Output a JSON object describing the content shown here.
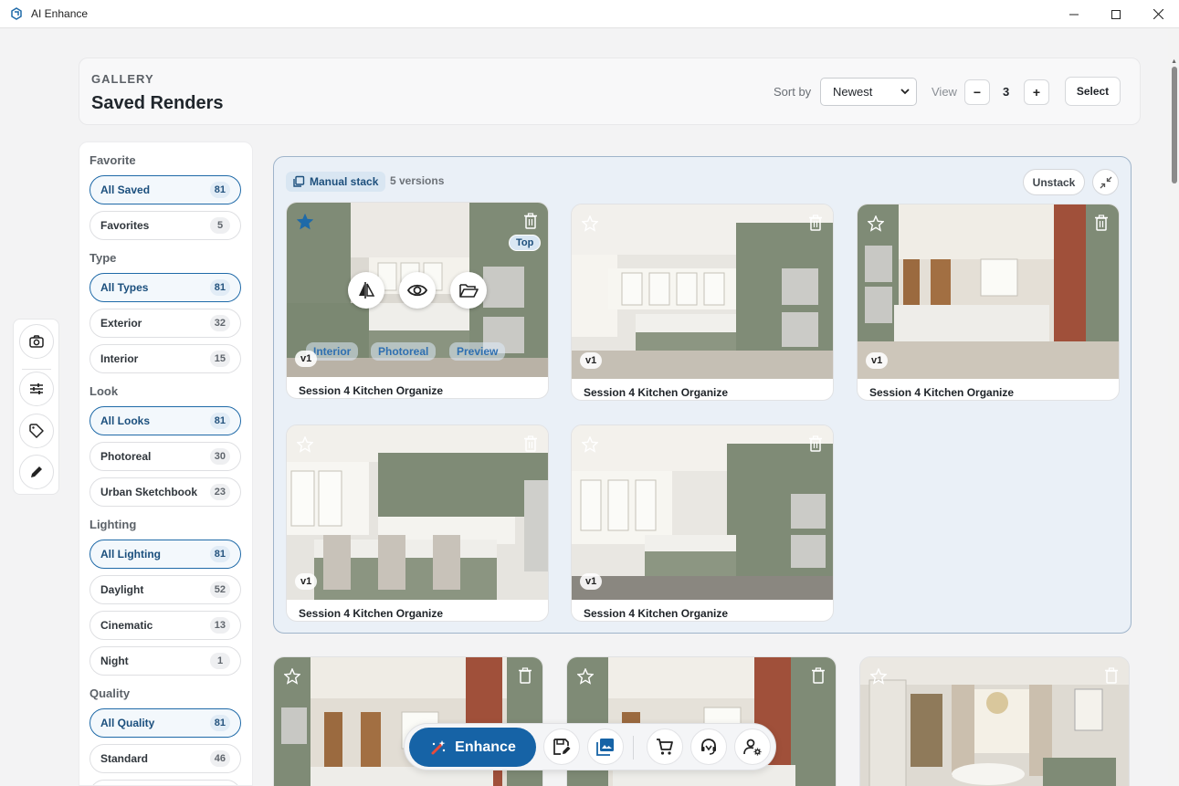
{
  "window": {
    "title": "AI Enhance",
    "minimize_icon": "minimize-icon",
    "maximize_icon": "maximize-icon",
    "close_icon": "close-icon"
  },
  "header": {
    "eyebrow": "GALLERY",
    "title": "Saved Renders",
    "sort_label": "Sort by",
    "sort_value": "Newest",
    "view_label": "View",
    "view_minus": "−",
    "view_count": "3",
    "view_plus": "+",
    "select_label": "Select"
  },
  "sidebar": {
    "favorite": {
      "title": "Favorite",
      "items": [
        {
          "label": "All Saved",
          "count": "81"
        },
        {
          "label": "Favorites",
          "count": "5"
        }
      ]
    },
    "type": {
      "title": "Type",
      "items": [
        {
          "label": "All Types",
          "count": "81"
        },
        {
          "label": "Exterior",
          "count": "32"
        },
        {
          "label": "Interior",
          "count": "15"
        }
      ]
    },
    "look": {
      "title": "Look",
      "items": [
        {
          "label": "All Looks",
          "count": "81"
        },
        {
          "label": "Photoreal",
          "count": "30"
        },
        {
          "label": "Urban Sketchbook",
          "count": "23"
        }
      ]
    },
    "lighting": {
      "title": "Lighting",
      "items": [
        {
          "label": "All Lighting",
          "count": "81"
        },
        {
          "label": "Daylight",
          "count": "52"
        },
        {
          "label": "Cinematic",
          "count": "13"
        },
        {
          "label": "Night",
          "count": "1"
        }
      ]
    },
    "quality": {
      "title": "Quality",
      "items": [
        {
          "label": "All Quality",
          "count": "81"
        },
        {
          "label": "Standard",
          "count": "46"
        }
      ]
    }
  },
  "tools": [
    "camera-icon",
    "sliders-icon",
    "tag-icon",
    "pencil-icon"
  ],
  "stack": {
    "badge": "Manual stack",
    "count": "5 versions",
    "unstack_label": "Unstack",
    "cards": [
      {
        "title": "Session 4 Kitchen Organize",
        "version": "v1",
        "favorite": true,
        "top_badge": "Top",
        "overlay_labels": [
          "Interior",
          "Photoreal",
          "Preview"
        ]
      },
      {
        "title": "Session 4 Kitchen Organize",
        "version": "v1",
        "favorite": false
      },
      {
        "title": "Session 4 Kitchen Organize",
        "version": "v1",
        "favorite": false
      },
      {
        "title": "Session 4 Kitchen Organize",
        "version": "v1",
        "favorite": false
      },
      {
        "title": "Session 4 Kitchen Organize",
        "version": "v1",
        "favorite": false
      }
    ]
  },
  "dock": {
    "enhance_label": "Enhance",
    "buttons": [
      "save-edit-icon",
      "gallery-icon",
      "cart-icon",
      "support-icon",
      "user-settings-icon"
    ]
  },
  "colors": {
    "accent": "#1663a6",
    "stack_bg": "#eaf0f7",
    "cabinet": "#7f8b76"
  }
}
